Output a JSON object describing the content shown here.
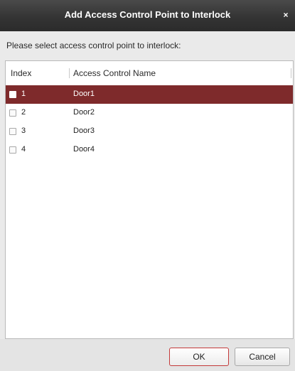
{
  "dialog": {
    "title": "Add Access Control Point to Interlock",
    "close_glyph": "×",
    "prompt": "Please select access control point to interlock:"
  },
  "table": {
    "columns": [
      "Index",
      "Access Control Name"
    ],
    "rows": [
      {
        "index": "1",
        "name": "Door1",
        "selected": true,
        "checked": false
      },
      {
        "index": "2",
        "name": "Door2",
        "selected": false,
        "checked": false
      },
      {
        "index": "3",
        "name": "Door3",
        "selected": false,
        "checked": false
      },
      {
        "index": "4",
        "name": "Door4",
        "selected": false,
        "checked": false
      }
    ]
  },
  "buttons": {
    "ok": "OK",
    "cancel": "Cancel"
  },
  "colors": {
    "selected_row": "#7e2a2b",
    "titlebar": "#343434",
    "ok_border": "#c43a3a"
  }
}
